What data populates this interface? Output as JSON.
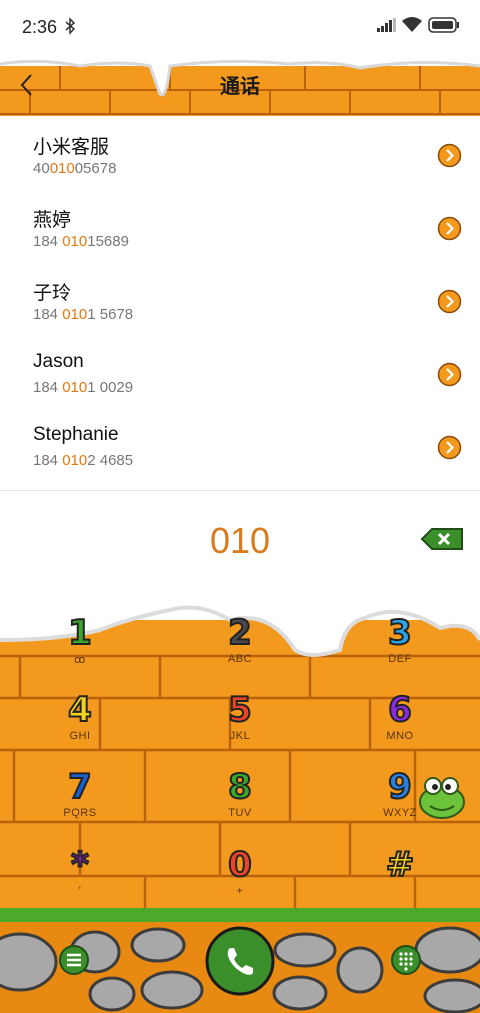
{
  "status_bar": {
    "time": "2:36"
  },
  "header": {
    "title": "通话"
  },
  "contacts": [
    {
      "name": "小米客服",
      "number_pre": "40",
      "number_hl": "010",
      "number_post": "05678"
    },
    {
      "name": "燕婷",
      "number_pre": "184 ",
      "number_hl": "010",
      "number_post": "15689"
    },
    {
      "name": "子玲",
      "number_pre": "184 ",
      "number_hl": "010",
      "number_post": "1 5678"
    },
    {
      "name": "Jason",
      "number_pre": "184 ",
      "number_hl": "010",
      "number_post": "1 0029"
    },
    {
      "name": "Stephanie",
      "number_pre": "184 ",
      "number_hl": "010",
      "number_post": "2 4685"
    }
  ],
  "dialer": {
    "number": "010"
  },
  "keypad": [
    {
      "digit": "1",
      "letters": "ꝏ",
      "color": "#3aa62e"
    },
    {
      "digit": "2",
      "letters": "ABC",
      "color": "#4a4a4a"
    },
    {
      "digit": "3",
      "letters": "DEF",
      "color": "#2aa6e8"
    },
    {
      "digit": "4",
      "letters": "GHI",
      "color": "#f5d21c"
    },
    {
      "digit": "5",
      "letters": "JKL",
      "color": "#e8442a"
    },
    {
      "digit": "6",
      "letters": "MNO",
      "color": "#8a2be2"
    },
    {
      "digit": "7",
      "letters": "PQRS",
      "color": "#1a5fd0"
    },
    {
      "digit": "8",
      "letters": "TUV",
      "color": "#3aa62e"
    },
    {
      "digit": "9",
      "letters": "WXYZ",
      "color": "#2a7fe0"
    },
    {
      "digit": "*",
      "letters": "'",
      "color": "#b02ad8"
    },
    {
      "digit": "0",
      "letters": "+",
      "color": "#e8442a"
    },
    {
      "digit": "#",
      "letters": "",
      "color": "#f5d21c"
    }
  ],
  "colors": {
    "brick": "#f39a1e",
    "mortar": "#c96e10",
    "accent": "#e07a10",
    "call_green": "#3a8f2a"
  }
}
